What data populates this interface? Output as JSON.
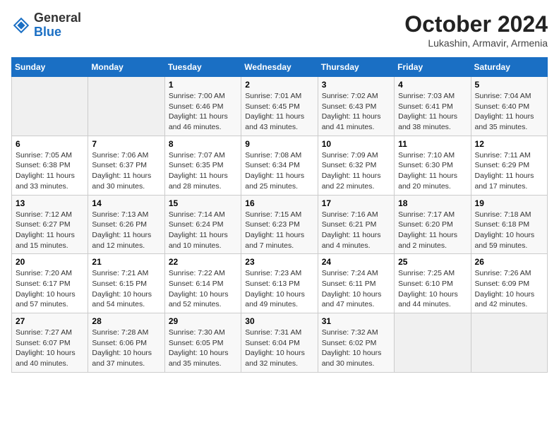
{
  "header": {
    "logo_general": "General",
    "logo_blue": "Blue",
    "month_title": "October 2024",
    "location": "Lukashin, Armavir, Armenia"
  },
  "weekdays": [
    "Sunday",
    "Monday",
    "Tuesday",
    "Wednesday",
    "Thursday",
    "Friday",
    "Saturday"
  ],
  "weeks": [
    [
      {
        "day": "",
        "sunrise": "",
        "sunset": "",
        "daylight": ""
      },
      {
        "day": "",
        "sunrise": "",
        "sunset": "",
        "daylight": ""
      },
      {
        "day": "1",
        "sunrise": "Sunrise: 7:00 AM",
        "sunset": "Sunset: 6:46 PM",
        "daylight": "Daylight: 11 hours and 46 minutes."
      },
      {
        "day": "2",
        "sunrise": "Sunrise: 7:01 AM",
        "sunset": "Sunset: 6:45 PM",
        "daylight": "Daylight: 11 hours and 43 minutes."
      },
      {
        "day": "3",
        "sunrise": "Sunrise: 7:02 AM",
        "sunset": "Sunset: 6:43 PM",
        "daylight": "Daylight: 11 hours and 41 minutes."
      },
      {
        "day": "4",
        "sunrise": "Sunrise: 7:03 AM",
        "sunset": "Sunset: 6:41 PM",
        "daylight": "Daylight: 11 hours and 38 minutes."
      },
      {
        "day": "5",
        "sunrise": "Sunrise: 7:04 AM",
        "sunset": "Sunset: 6:40 PM",
        "daylight": "Daylight: 11 hours and 35 minutes."
      }
    ],
    [
      {
        "day": "6",
        "sunrise": "Sunrise: 7:05 AM",
        "sunset": "Sunset: 6:38 PM",
        "daylight": "Daylight: 11 hours and 33 minutes."
      },
      {
        "day": "7",
        "sunrise": "Sunrise: 7:06 AM",
        "sunset": "Sunset: 6:37 PM",
        "daylight": "Daylight: 11 hours and 30 minutes."
      },
      {
        "day": "8",
        "sunrise": "Sunrise: 7:07 AM",
        "sunset": "Sunset: 6:35 PM",
        "daylight": "Daylight: 11 hours and 28 minutes."
      },
      {
        "day": "9",
        "sunrise": "Sunrise: 7:08 AM",
        "sunset": "Sunset: 6:34 PM",
        "daylight": "Daylight: 11 hours and 25 minutes."
      },
      {
        "day": "10",
        "sunrise": "Sunrise: 7:09 AM",
        "sunset": "Sunset: 6:32 PM",
        "daylight": "Daylight: 11 hours and 22 minutes."
      },
      {
        "day": "11",
        "sunrise": "Sunrise: 7:10 AM",
        "sunset": "Sunset: 6:30 PM",
        "daylight": "Daylight: 11 hours and 20 minutes."
      },
      {
        "day": "12",
        "sunrise": "Sunrise: 7:11 AM",
        "sunset": "Sunset: 6:29 PM",
        "daylight": "Daylight: 11 hours and 17 minutes."
      }
    ],
    [
      {
        "day": "13",
        "sunrise": "Sunrise: 7:12 AM",
        "sunset": "Sunset: 6:27 PM",
        "daylight": "Daylight: 11 hours and 15 minutes."
      },
      {
        "day": "14",
        "sunrise": "Sunrise: 7:13 AM",
        "sunset": "Sunset: 6:26 PM",
        "daylight": "Daylight: 11 hours and 12 minutes."
      },
      {
        "day": "15",
        "sunrise": "Sunrise: 7:14 AM",
        "sunset": "Sunset: 6:24 PM",
        "daylight": "Daylight: 11 hours and 10 minutes."
      },
      {
        "day": "16",
        "sunrise": "Sunrise: 7:15 AM",
        "sunset": "Sunset: 6:23 PM",
        "daylight": "Daylight: 11 hours and 7 minutes."
      },
      {
        "day": "17",
        "sunrise": "Sunrise: 7:16 AM",
        "sunset": "Sunset: 6:21 PM",
        "daylight": "Daylight: 11 hours and 4 minutes."
      },
      {
        "day": "18",
        "sunrise": "Sunrise: 7:17 AM",
        "sunset": "Sunset: 6:20 PM",
        "daylight": "Daylight: 11 hours and 2 minutes."
      },
      {
        "day": "19",
        "sunrise": "Sunrise: 7:18 AM",
        "sunset": "Sunset: 6:18 PM",
        "daylight": "Daylight: 10 hours and 59 minutes."
      }
    ],
    [
      {
        "day": "20",
        "sunrise": "Sunrise: 7:20 AM",
        "sunset": "Sunset: 6:17 PM",
        "daylight": "Daylight: 10 hours and 57 minutes."
      },
      {
        "day": "21",
        "sunrise": "Sunrise: 7:21 AM",
        "sunset": "Sunset: 6:15 PM",
        "daylight": "Daylight: 10 hours and 54 minutes."
      },
      {
        "day": "22",
        "sunrise": "Sunrise: 7:22 AM",
        "sunset": "Sunset: 6:14 PM",
        "daylight": "Daylight: 10 hours and 52 minutes."
      },
      {
        "day": "23",
        "sunrise": "Sunrise: 7:23 AM",
        "sunset": "Sunset: 6:13 PM",
        "daylight": "Daylight: 10 hours and 49 minutes."
      },
      {
        "day": "24",
        "sunrise": "Sunrise: 7:24 AM",
        "sunset": "Sunset: 6:11 PM",
        "daylight": "Daylight: 10 hours and 47 minutes."
      },
      {
        "day": "25",
        "sunrise": "Sunrise: 7:25 AM",
        "sunset": "Sunset: 6:10 PM",
        "daylight": "Daylight: 10 hours and 44 minutes."
      },
      {
        "day": "26",
        "sunrise": "Sunrise: 7:26 AM",
        "sunset": "Sunset: 6:09 PM",
        "daylight": "Daylight: 10 hours and 42 minutes."
      }
    ],
    [
      {
        "day": "27",
        "sunrise": "Sunrise: 7:27 AM",
        "sunset": "Sunset: 6:07 PM",
        "daylight": "Daylight: 10 hours and 40 minutes."
      },
      {
        "day": "28",
        "sunrise": "Sunrise: 7:28 AM",
        "sunset": "Sunset: 6:06 PM",
        "daylight": "Daylight: 10 hours and 37 minutes."
      },
      {
        "day": "29",
        "sunrise": "Sunrise: 7:30 AM",
        "sunset": "Sunset: 6:05 PM",
        "daylight": "Daylight: 10 hours and 35 minutes."
      },
      {
        "day": "30",
        "sunrise": "Sunrise: 7:31 AM",
        "sunset": "Sunset: 6:04 PM",
        "daylight": "Daylight: 10 hours and 32 minutes."
      },
      {
        "day": "31",
        "sunrise": "Sunrise: 7:32 AM",
        "sunset": "Sunset: 6:02 PM",
        "daylight": "Daylight: 10 hours and 30 minutes."
      },
      {
        "day": "",
        "sunrise": "",
        "sunset": "",
        "daylight": ""
      },
      {
        "day": "",
        "sunrise": "",
        "sunset": "",
        "daylight": ""
      }
    ]
  ]
}
